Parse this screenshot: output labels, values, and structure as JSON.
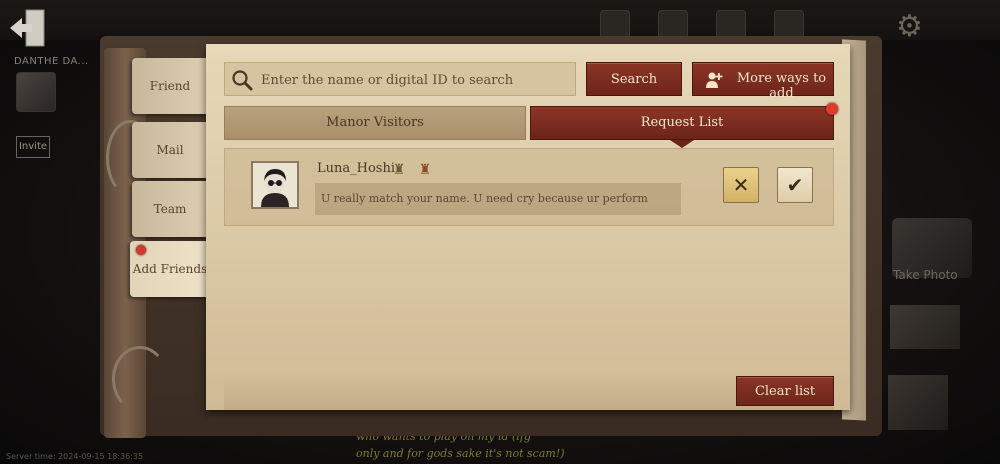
{
  "background": {
    "player_name": "DANTHE DA...",
    "invite_label": "Invite",
    "take_photo_label": "Take Photo",
    "chat_line_1": "who wants to play on my id (lfg",
    "chat_line_2": "only and for gods sake it's not scam!)",
    "server_time": "Server time: 2024-09-15 18:36:35"
  },
  "side_tabs": [
    {
      "label": "Friend",
      "active": false,
      "has_dot": false
    },
    {
      "label": "Mail",
      "active": false,
      "has_dot": false
    },
    {
      "label": "Team",
      "active": false,
      "has_dot": false
    },
    {
      "label": "Add Friends",
      "active": true,
      "has_dot": true
    }
  ],
  "search": {
    "placeholder": "Enter the name or digital ID to search",
    "value": "",
    "search_label": "Search",
    "more_label": "More ways to add"
  },
  "tabs": {
    "visitors_label": "Manor Visitors",
    "requests_label": "Request List",
    "active": "requests"
  },
  "requests": [
    {
      "name": "Luna_Hoshi",
      "message": "U really match your name. U need cry because ur perform",
      "reject_symbol": "✕",
      "accept_symbol": "✔"
    }
  ],
  "clear_label": "Clear list",
  "colors": {
    "accent_red": "#7a2c1e",
    "paper": "#e6d8b8",
    "notification_dot": "#e03a2a"
  },
  "icons": {
    "exit": "exit-door-icon",
    "search": "magnifier-icon",
    "add_user": "add-user-icon",
    "settings": "gear-icon"
  }
}
